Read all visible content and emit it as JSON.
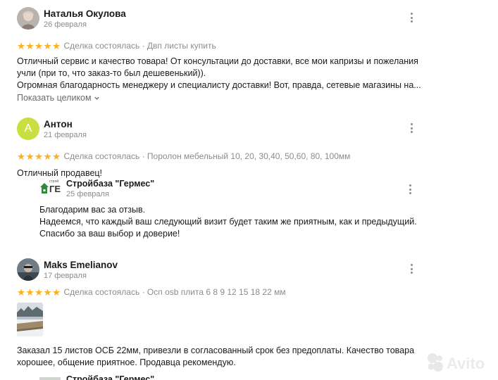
{
  "reviews": [
    {
      "name": "Наталья Окулова",
      "date": "26 февраля",
      "deal": "Сделка состоялась · Двп листы купить",
      "rating": 5,
      "text": [
        "Отличный сервис и качество товара! От консультации до доставки, все мои капризы и пожелания",
        "учли (при то, что заказ-то был дешевенький)).",
        "Огромная благодарность менеджеру и специалисту доставки! Вот, правда, сетевые магазины на..."
      ],
      "show_more": "Показать целиком"
    },
    {
      "name": "Антон",
      "avatar_letter": "А",
      "date": "21 февраля",
      "deal": "Сделка состоялась · Поролон мебельный 10, 20, 30,40, 50,60, 80, 100мм",
      "rating": 5,
      "text": [
        "Отличный продавец!"
      ],
      "reply": {
        "name": "Стройбаза \"Гермес\"",
        "date": "25 февраля",
        "logo_text": "ГЕ",
        "logo_small": "строй",
        "text": [
          "Благодарим вас за отзыв.",
          "Надеемся, что каждый ваш следующий визит будет таким же приятным, как и предыдущий.",
          "Спасибо за ваш выбор и доверие!"
        ]
      }
    },
    {
      "name": "Maks Emelianov",
      "date": "17 февраля",
      "deal": "Сделка состоялась · Осп osb плита 6 8 9 12 15 18 22 мм",
      "rating": 5,
      "text": [
        "Заказал 15 листов ОСБ 22мм, привезли в согласованный срок без предоплаты. Качество товара",
        "хорошее, общение приятное. Продавца рекомендую."
      ],
      "reply_name_partial": "Стройбаза \"Гермес\""
    }
  ],
  "colors": {
    "star": "#ffb021",
    "muted": "#8c8c8c",
    "avatar_green": "#c8df3f"
  },
  "watermark": "Avito"
}
